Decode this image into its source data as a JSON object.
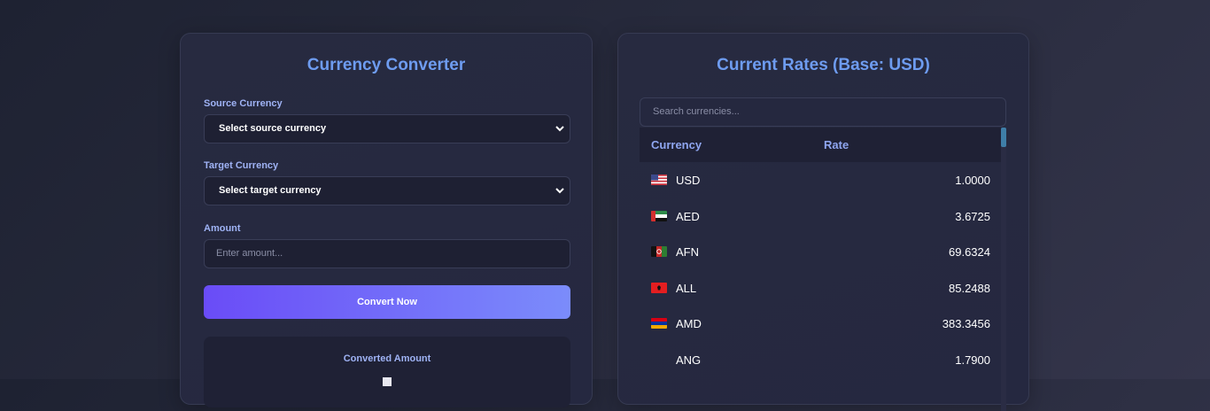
{
  "converter": {
    "title": "Currency Converter",
    "source_label": "Source Currency",
    "source_value": "Select source currency",
    "target_label": "Target Currency",
    "target_value": "Select target currency",
    "amount_label": "Amount",
    "amount_placeholder": "Enter amount...",
    "convert_label": "Convert Now",
    "result_label": "Converted Amount"
  },
  "rates": {
    "title": "Current Rates (Base: USD)",
    "search_placeholder": "Search currencies...",
    "col_currency": "Currency",
    "col_rate": "Rate",
    "rows": [
      {
        "code": "USD",
        "rate": "1.0000",
        "flag": "us-flag"
      },
      {
        "code": "AED",
        "rate": "3.6725",
        "flag": "ae-flag"
      },
      {
        "code": "AFN",
        "rate": "69.6324",
        "flag": "af-flag"
      },
      {
        "code": "ALL",
        "rate": "85.2488",
        "flag": "al-flag"
      },
      {
        "code": "AMD",
        "rate": "383.3456",
        "flag": "am-flag"
      },
      {
        "code": "ANG",
        "rate": "1.7900",
        "flag": ""
      }
    ]
  },
  "colors": {
    "accent": "#6e9cf0",
    "button_start": "#6a4cf7",
    "button_end": "#7b8cfb"
  }
}
